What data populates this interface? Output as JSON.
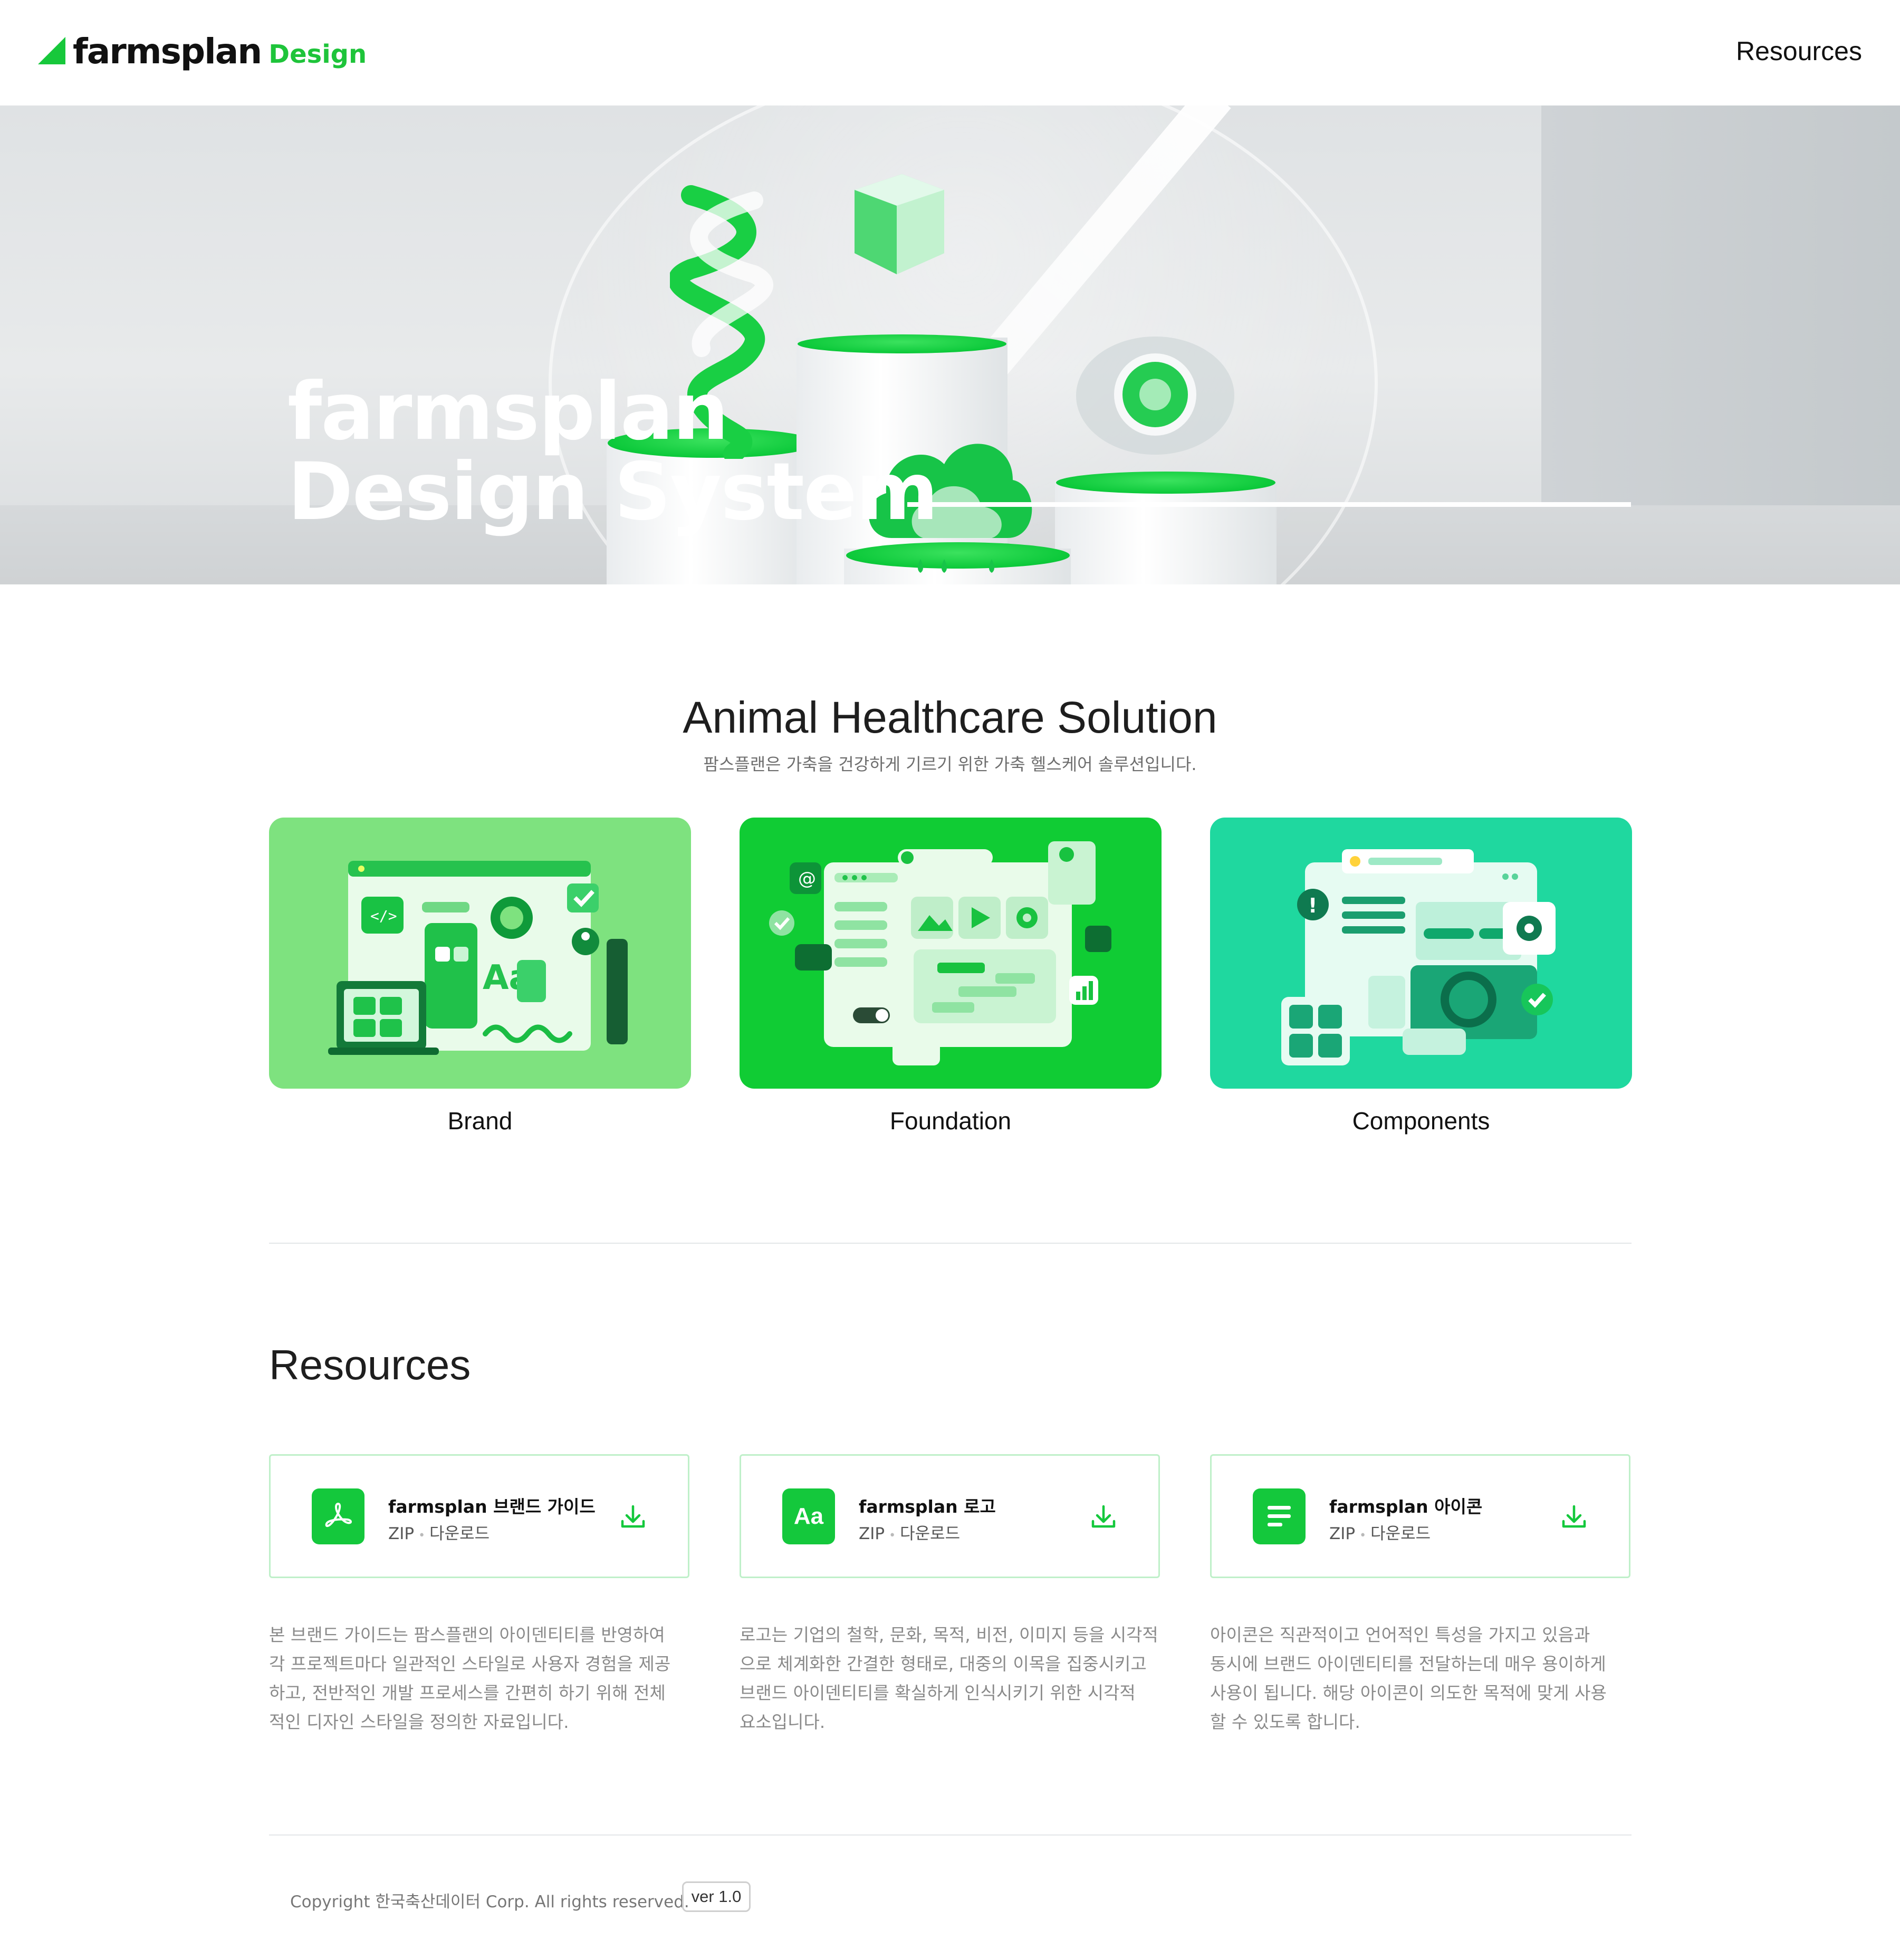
{
  "header": {
    "logo_word": "farmsplan",
    "logo_sub": "Design",
    "nav_resources": "Resources"
  },
  "hero": {
    "title_line1": "farmsplan",
    "title_line2": "Design System"
  },
  "intro": {
    "title": "Animal Healthcare Solution",
    "subtitle": "팜스플랜은 가축을 건강하게 기르기 위한 가축 헬스케어 솔루션입니다."
  },
  "categories": [
    {
      "label": "Brand",
      "color": "#7ee27f"
    },
    {
      "label": "Foundation",
      "color": "#10cc34"
    },
    {
      "label": "Components",
      "color": "#1fd89f"
    }
  ],
  "resources": {
    "title": "Resources",
    "items": [
      {
        "name": "farmsplan 브랜드 가이드",
        "format": "ZIP",
        "action": "다운로드",
        "icon": "pdf-icon",
        "desc": [
          "본 브랜드 가이드는 팜스플랜의 아이덴티티를 반영하여",
          "각 프로젝트마다 일관적인 스타일로 사용자 경험을 제공",
          "하고, 전반적인 개발 프로세스를 간편히 하기 위해 전체",
          "적인 디자인 스타일을 정의한 자료입니다."
        ]
      },
      {
        "name": "farmsplan 로고",
        "format": "ZIP",
        "action": "다운로드",
        "icon": "font-icon",
        "icon_text": "Aa",
        "desc": [
          "로고는 기업의 철학, 문화, 목적, 비전, 이미지 등을 시각적",
          "으로 체계화한 간결한 형태로, 대중의 이목을 집중시키고",
          "브랜드 아이덴티티를 확실하게 인식시키기 위한 시각적",
          "요소입니다."
        ]
      },
      {
        "name": "farmsplan 아이콘",
        "format": "ZIP",
        "action": "다운로드",
        "icon": "document-lines-icon",
        "desc": [
          "아이콘은 직관적이고 언어적인 특성을 가지고 있음과",
          "동시에 브랜드 아이덴티티를 전달하는데 매우 용이하게",
          "사용이 됩니다. 해당 아이콘이 의도한 목적에 맞게 사용",
          "할 수 있도록 합니다."
        ]
      }
    ]
  },
  "footer": {
    "copyright": "Copyright 한국축산데이터 Corp. All rights reserved.",
    "version": "ver 1.0"
  },
  "colors": {
    "brand_green": "#14c83c",
    "card_border": "#bff0c9"
  }
}
